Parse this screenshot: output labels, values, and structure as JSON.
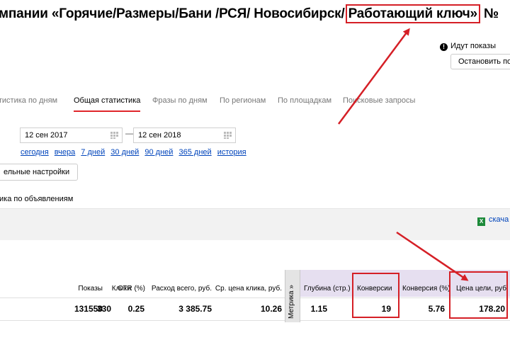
{
  "header": {
    "title_prefix": "мпании",
    "campaign_name": "«Горячие/Размеры/Бани /РСЯ/ Новосибирск/",
    "campaign_highlight": "Работающий ключ»",
    "title_suffix": " №"
  },
  "status": {
    "text": "Идут показы",
    "stop_label": "Остановить по"
  },
  "tabs": [
    {
      "label": "атистика по дням",
      "active": false
    },
    {
      "label": "Общая статистика",
      "active": true
    },
    {
      "label": "Фразы по дням",
      "active": false
    },
    {
      "label": "По регионам",
      "active": false
    },
    {
      "label": "По площадкам",
      "active": false
    },
    {
      "label": "Поисковые запросы",
      "active": false
    }
  ],
  "dates": {
    "from": "12 сен 2017",
    "separator": "—",
    "to": "12 сен 2018"
  },
  "quick_ranges": [
    "сегодня",
    "вчера",
    "7 дней",
    "30 дней",
    "90 дней",
    "365 дней",
    "история"
  ],
  "settings_button": "ельные настройки",
  "section_label": "тика по объявлениям",
  "download_label": "скача",
  "table": {
    "headers": {
      "impressions": "Показы",
      "clicks": "Клики",
      "ctr": "CTR (%)",
      "spend": "Расход всего, руб.",
      "avg_cpc": "Ср. цена клика, руб.",
      "metrika": "Метрика »",
      "depth": "Глубина (стр.)",
      "conversions": "Конверсии",
      "conv_rate": "Конверсия (%)",
      "cpa": "Цена цели, руб."
    },
    "row": {
      "impressions": "131550",
      "clicks": "330",
      "ctr": "0.25",
      "spend": "3 385.75",
      "avg_cpc": "10.26",
      "depth": "1.15",
      "conversions": "19",
      "conv_rate": "5.76",
      "cpa": "178.20"
    }
  },
  "colors": {
    "accent_red": "#d51f26",
    "link_blue": "#0044bb",
    "tab_underline": "#e0262b",
    "goal_band": "#e6dff0"
  }
}
